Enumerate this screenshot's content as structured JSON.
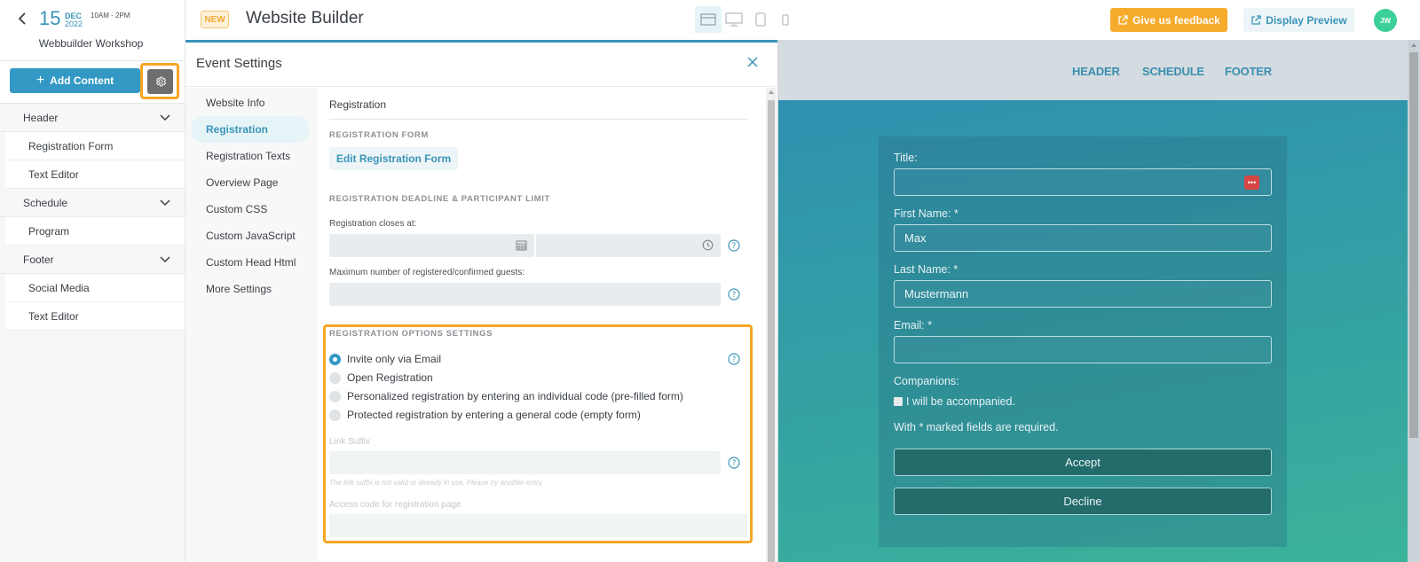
{
  "event": {
    "day": "15",
    "month": "DEC",
    "year": "2022",
    "time": "10AM - 2PM",
    "name": "Webbuilder Workshop"
  },
  "sidebar": {
    "add_content_label": "Add Content",
    "groups": [
      {
        "label": "Header",
        "items": [
          "Registration Form",
          "Text Editor"
        ]
      },
      {
        "label": "Schedule",
        "items": [
          "Program"
        ]
      },
      {
        "label": "Footer",
        "items": [
          "Social Media",
          "Text Editor"
        ]
      }
    ]
  },
  "topbar": {
    "badge": "NEW",
    "title": "Website Builder",
    "devices": [
      "layout-view",
      "desktop",
      "tablet",
      "mobile"
    ],
    "active_device": "layout-view",
    "feedback_label": "Give us feedback",
    "preview_label": "Display Preview",
    "avatar_initials": "JW"
  },
  "settings": {
    "title": "Event Settings",
    "nav": [
      {
        "label": "Website Info",
        "active": false
      },
      {
        "label": "Registration",
        "active": true
      },
      {
        "label": "Registration Texts",
        "active": false
      },
      {
        "label": "Overview Page",
        "active": false
      },
      {
        "label": "Custom CSS",
        "active": false
      },
      {
        "label": "Custom JavaScript",
        "active": false
      },
      {
        "label": "Custom Head Html",
        "active": false
      },
      {
        "label": "More Settings",
        "active": false
      }
    ],
    "content": {
      "title": "Registration",
      "form_section": "REGISTRATION FORM",
      "edit_form_label": "Edit Registration Form",
      "deadline_section": "REGISTRATION DEADLINE & PARTICIPANT LIMIT",
      "closes_label": "Registration closes at:",
      "closes_date_value": "",
      "closes_time_value": "",
      "max_guests_label": "Maximum number of registered/confirmed guests:",
      "max_guests_value": "",
      "options_section": "REGISTRATION OPTIONS SETTINGS",
      "options": [
        {
          "label": "Invite only via Email",
          "checked": true
        },
        {
          "label": "Open Registration",
          "checked": false
        },
        {
          "label": "Personalized registration by entering an individual code (pre-filled form)",
          "checked": false
        },
        {
          "label": "Protected registration by entering a general code (empty form)",
          "checked": false
        }
      ],
      "link_suffix_label": "Link Suffix",
      "link_suffix_value": "",
      "link_suffix_error": "The link suffix is not valid or already in use. Please try another entry.",
      "access_code_label": "Access code for registration page",
      "access_code_value": ""
    }
  },
  "preview": {
    "nav": [
      "HEADER",
      "SCHEDULE",
      "FOOTER"
    ],
    "form": {
      "title_label": "Title:",
      "title_value": "",
      "title_badge": "•••",
      "first_name_label": "First Name: *",
      "first_name_value": "Max",
      "last_name_label": "Last Name: *",
      "last_name_value": "Mustermann",
      "email_label": "Email: *",
      "email_value": "",
      "companions_label": "Companions:",
      "companions_checkbox": "I will be accompanied.",
      "required_note": "With * marked fields are required.",
      "accept_label": "Accept",
      "decline_label": "Decline"
    }
  },
  "colors": {
    "accent": "#3399c4",
    "highlight": "#f5a623",
    "feedback": "#f7ab2c",
    "avatar": "#3ccf9a"
  }
}
